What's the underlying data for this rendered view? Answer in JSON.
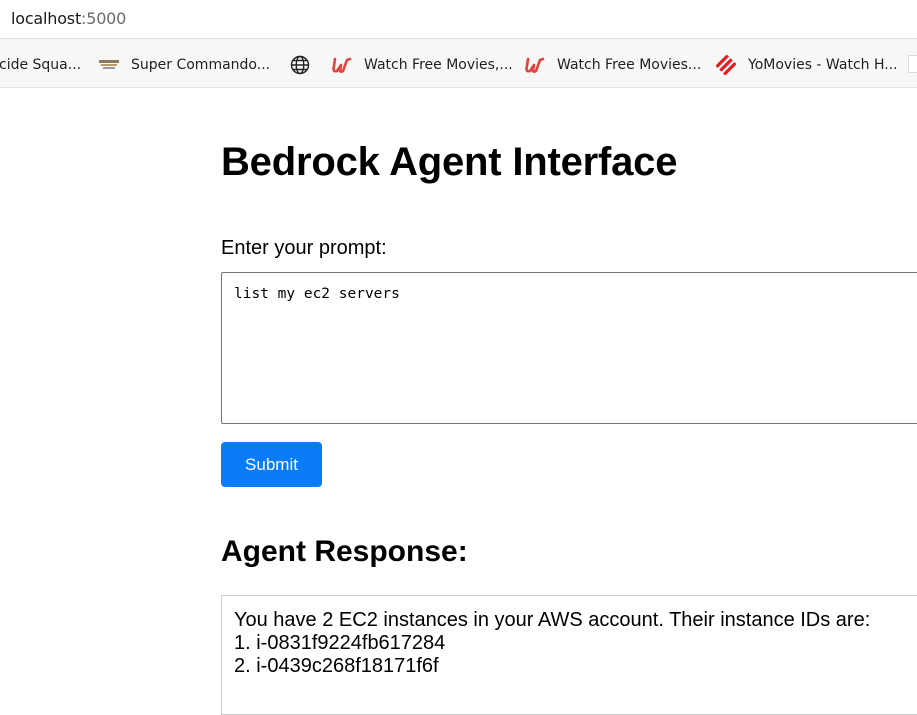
{
  "browser": {
    "url_host": "localhost",
    "url_port": ":5000",
    "bookmarks": [
      {
        "label": "cide Squa...",
        "icon": "none"
      },
      {
        "label": "Super Commando...",
        "icon": "site-favicon"
      },
      {
        "label": "",
        "icon": "globe-icon"
      },
      {
        "label": "Watch Free Movies,...",
        "icon": "u-logo-icon"
      },
      {
        "label": "Watch Free Movies...",
        "icon": "u-logo-icon"
      },
      {
        "label": "YoMovies - Watch H...",
        "icon": "yomovies-icon"
      }
    ]
  },
  "page": {
    "title": "Bedrock Agent Interface",
    "prompt_label": "Enter your prompt:",
    "prompt_value": "list my ec2 servers",
    "submit_label": "Submit",
    "response_heading": "Agent Response:",
    "response_lines": [
      "You have 2 EC2 instances in your AWS account. Their instance IDs are:",
      "1. i-0831f9224fb617284",
      "2. i-0439c268f18171f6f"
    ]
  },
  "colors": {
    "accent": "#0a7cf8",
    "u_logo": "#e0443e",
    "yomovies": "#e02020"
  }
}
